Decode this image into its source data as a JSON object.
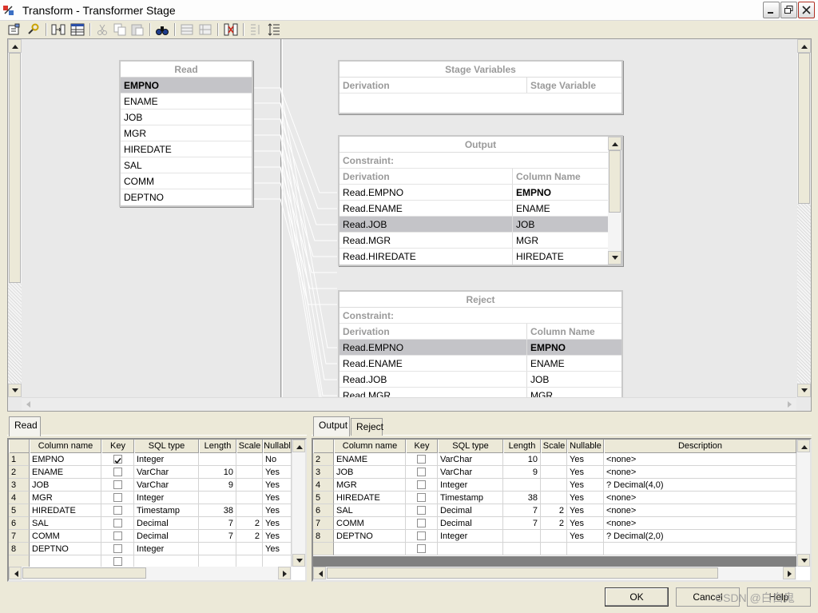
{
  "window": {
    "title": "Transform - Transformer Stage"
  },
  "read_box": {
    "title": "Read",
    "columns": [
      "EMPNO",
      "ENAME",
      "JOB",
      "MGR",
      "HIREDATE",
      "SAL",
      "COMM",
      "DEPTNO"
    ]
  },
  "stage_variables": {
    "title": "Stage Variables",
    "col_derivation": "Derivation",
    "col_stage_variable": "Stage Variable"
  },
  "output_box": {
    "title": "Output",
    "constraint": "Constraint:",
    "col_derivation": "Derivation",
    "col_column_name": "Column Name",
    "rows": [
      {
        "derivation": "Read.EMPNO",
        "column": "EMPNO"
      },
      {
        "derivation": "Read.ENAME",
        "column": "ENAME"
      },
      {
        "derivation": "Read.JOB",
        "column": "JOB"
      },
      {
        "derivation": "Read.MGR",
        "column": "MGR"
      },
      {
        "derivation": "Read.HIREDATE",
        "column": "HIREDATE"
      }
    ]
  },
  "reject_box": {
    "title": "Reject",
    "constraint": "Constraint:",
    "col_derivation": "Derivation",
    "col_column_name": "Column Name",
    "rows": [
      {
        "derivation": "Read.EMPNO",
        "column": "EMPNO"
      },
      {
        "derivation": "Read.ENAME",
        "column": "ENAME"
      },
      {
        "derivation": "Read.JOB",
        "column": "JOB"
      },
      {
        "derivation": "Read.MGR",
        "column": "MGR"
      }
    ]
  },
  "left_panel": {
    "tab": "Read",
    "headers": [
      "Column name",
      "Key",
      "SQL type",
      "Length",
      "Scale",
      "Nullabl"
    ],
    "rows": [
      {
        "n": "1",
        "name": "EMPNO",
        "key": true,
        "type": "Integer",
        "len": "",
        "scale": "",
        "null": "No"
      },
      {
        "n": "2",
        "name": "ENAME",
        "key": false,
        "type": "VarChar",
        "len": "10",
        "scale": "",
        "null": "Yes"
      },
      {
        "n": "3",
        "name": "JOB",
        "key": false,
        "type": "VarChar",
        "len": "9",
        "scale": "",
        "null": "Yes"
      },
      {
        "n": "4",
        "name": "MGR",
        "key": false,
        "type": "Integer",
        "len": "",
        "scale": "",
        "null": "Yes"
      },
      {
        "n": "5",
        "name": "HIREDATE",
        "key": false,
        "type": "Timestamp",
        "len": "38",
        "scale": "",
        "null": "Yes"
      },
      {
        "n": "6",
        "name": "SAL",
        "key": false,
        "type": "Decimal",
        "len": "7",
        "scale": "2",
        "null": "Yes"
      },
      {
        "n": "7",
        "name": "COMM",
        "key": false,
        "type": "Decimal",
        "len": "7",
        "scale": "2",
        "null": "Yes"
      },
      {
        "n": "8",
        "name": "DEPTNO",
        "key": false,
        "type": "Integer",
        "len": "",
        "scale": "",
        "null": "Yes"
      }
    ]
  },
  "right_panel": {
    "tabs": [
      "Output",
      "Reject"
    ],
    "headers": [
      "Column name",
      "Key",
      "SQL type",
      "Length",
      "Scale",
      "Nullable",
      "Description"
    ],
    "rows": [
      {
        "n": "2",
        "name": "ENAME",
        "key": false,
        "type": "VarChar",
        "len": "10",
        "scale": "",
        "null": "Yes",
        "desc": "<none>"
      },
      {
        "n": "3",
        "name": "JOB",
        "key": false,
        "type": "VarChar",
        "len": "9",
        "scale": "",
        "null": "Yes",
        "desc": "<none>"
      },
      {
        "n": "4",
        "name": "MGR",
        "key": false,
        "type": "Integer",
        "len": "",
        "scale": "",
        "null": "Yes",
        "desc": "? Decimal(4,0)"
      },
      {
        "n": "5",
        "name": "HIREDATE",
        "key": false,
        "type": "Timestamp",
        "len": "38",
        "scale": "",
        "null": "Yes",
        "desc": "<none>"
      },
      {
        "n": "6",
        "name": "SAL",
        "key": false,
        "type": "Decimal",
        "len": "7",
        "scale": "2",
        "null": "Yes",
        "desc": "<none>"
      },
      {
        "n": "7",
        "name": "COMM",
        "key": false,
        "type": "Decimal",
        "len": "7",
        "scale": "2",
        "null": "Yes",
        "desc": "<none>"
      },
      {
        "n": "8",
        "name": "DEPTNO",
        "key": false,
        "type": "Integer",
        "len": "",
        "scale": "",
        "null": "Yes",
        "desc": "? Decimal(2,0)"
      }
    ]
  },
  "buttons": {
    "ok": "OK",
    "cancel": "Cancel",
    "help": "Help"
  },
  "watermark": "CSDN @白白鬼"
}
